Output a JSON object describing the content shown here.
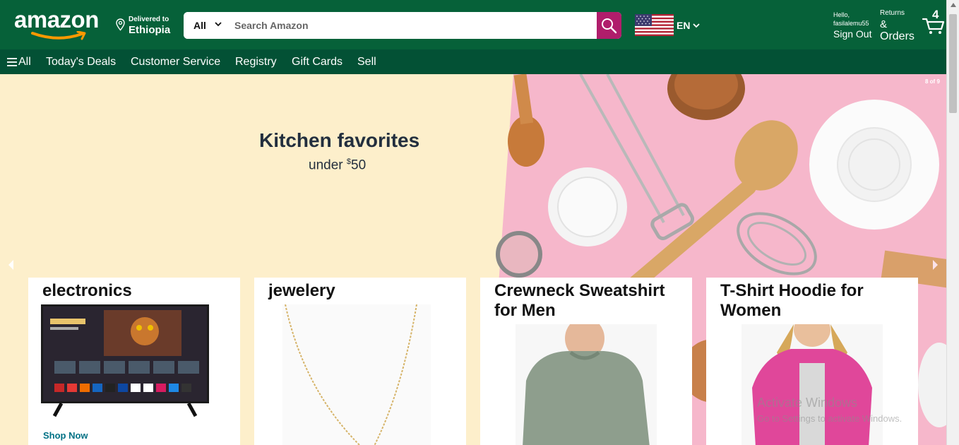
{
  "header": {
    "logo_text": "amazon",
    "deliver_line1": "Delivered to",
    "deliver_line2": "Ethiopia",
    "search_category": "All",
    "search_placeholder": "Search Amazon",
    "language": "EN",
    "greeting": "Hello,",
    "username": "fasilalemu55",
    "sign_out": "Sign Out",
    "returns_line1": "Returns",
    "returns_line2": "&",
    "returns_line3": "Orders",
    "cart_count": "4"
  },
  "nav": {
    "all": "All",
    "items": [
      "Today's Deals",
      "Customer Service",
      "Registry",
      "Gift Cards",
      "Sell"
    ]
  },
  "hero": {
    "title": "Kitchen favorites",
    "subtitle_prefix": "under ",
    "subtitle_currency": "$",
    "subtitle_amount": "50",
    "slide_counter": "8 of 9"
  },
  "cards": [
    {
      "title": "electronics",
      "link": "Shop Now"
    },
    {
      "title": "jewelery"
    },
    {
      "title": "Crewneck Sweatshirt for Men"
    },
    {
      "title": "T-Shirt Hoodie for Women"
    }
  ],
  "watermark": {
    "line1": "Activate Windows",
    "line2": "Go to Settings to activate Windows."
  },
  "colors": {
    "header_bg": "#066139",
    "nav_bg": "#035135",
    "search_button": "#b01d6b",
    "hero_bg": "#fdefcb",
    "hero_pink": "#f6b7cb",
    "link": "#007185"
  },
  "icons": [
    "location-pin-icon",
    "chevron-down-icon",
    "search-icon",
    "us-flag-icon",
    "cart-icon",
    "menu-icon",
    "arrow-left-icon",
    "arrow-right-icon"
  ]
}
